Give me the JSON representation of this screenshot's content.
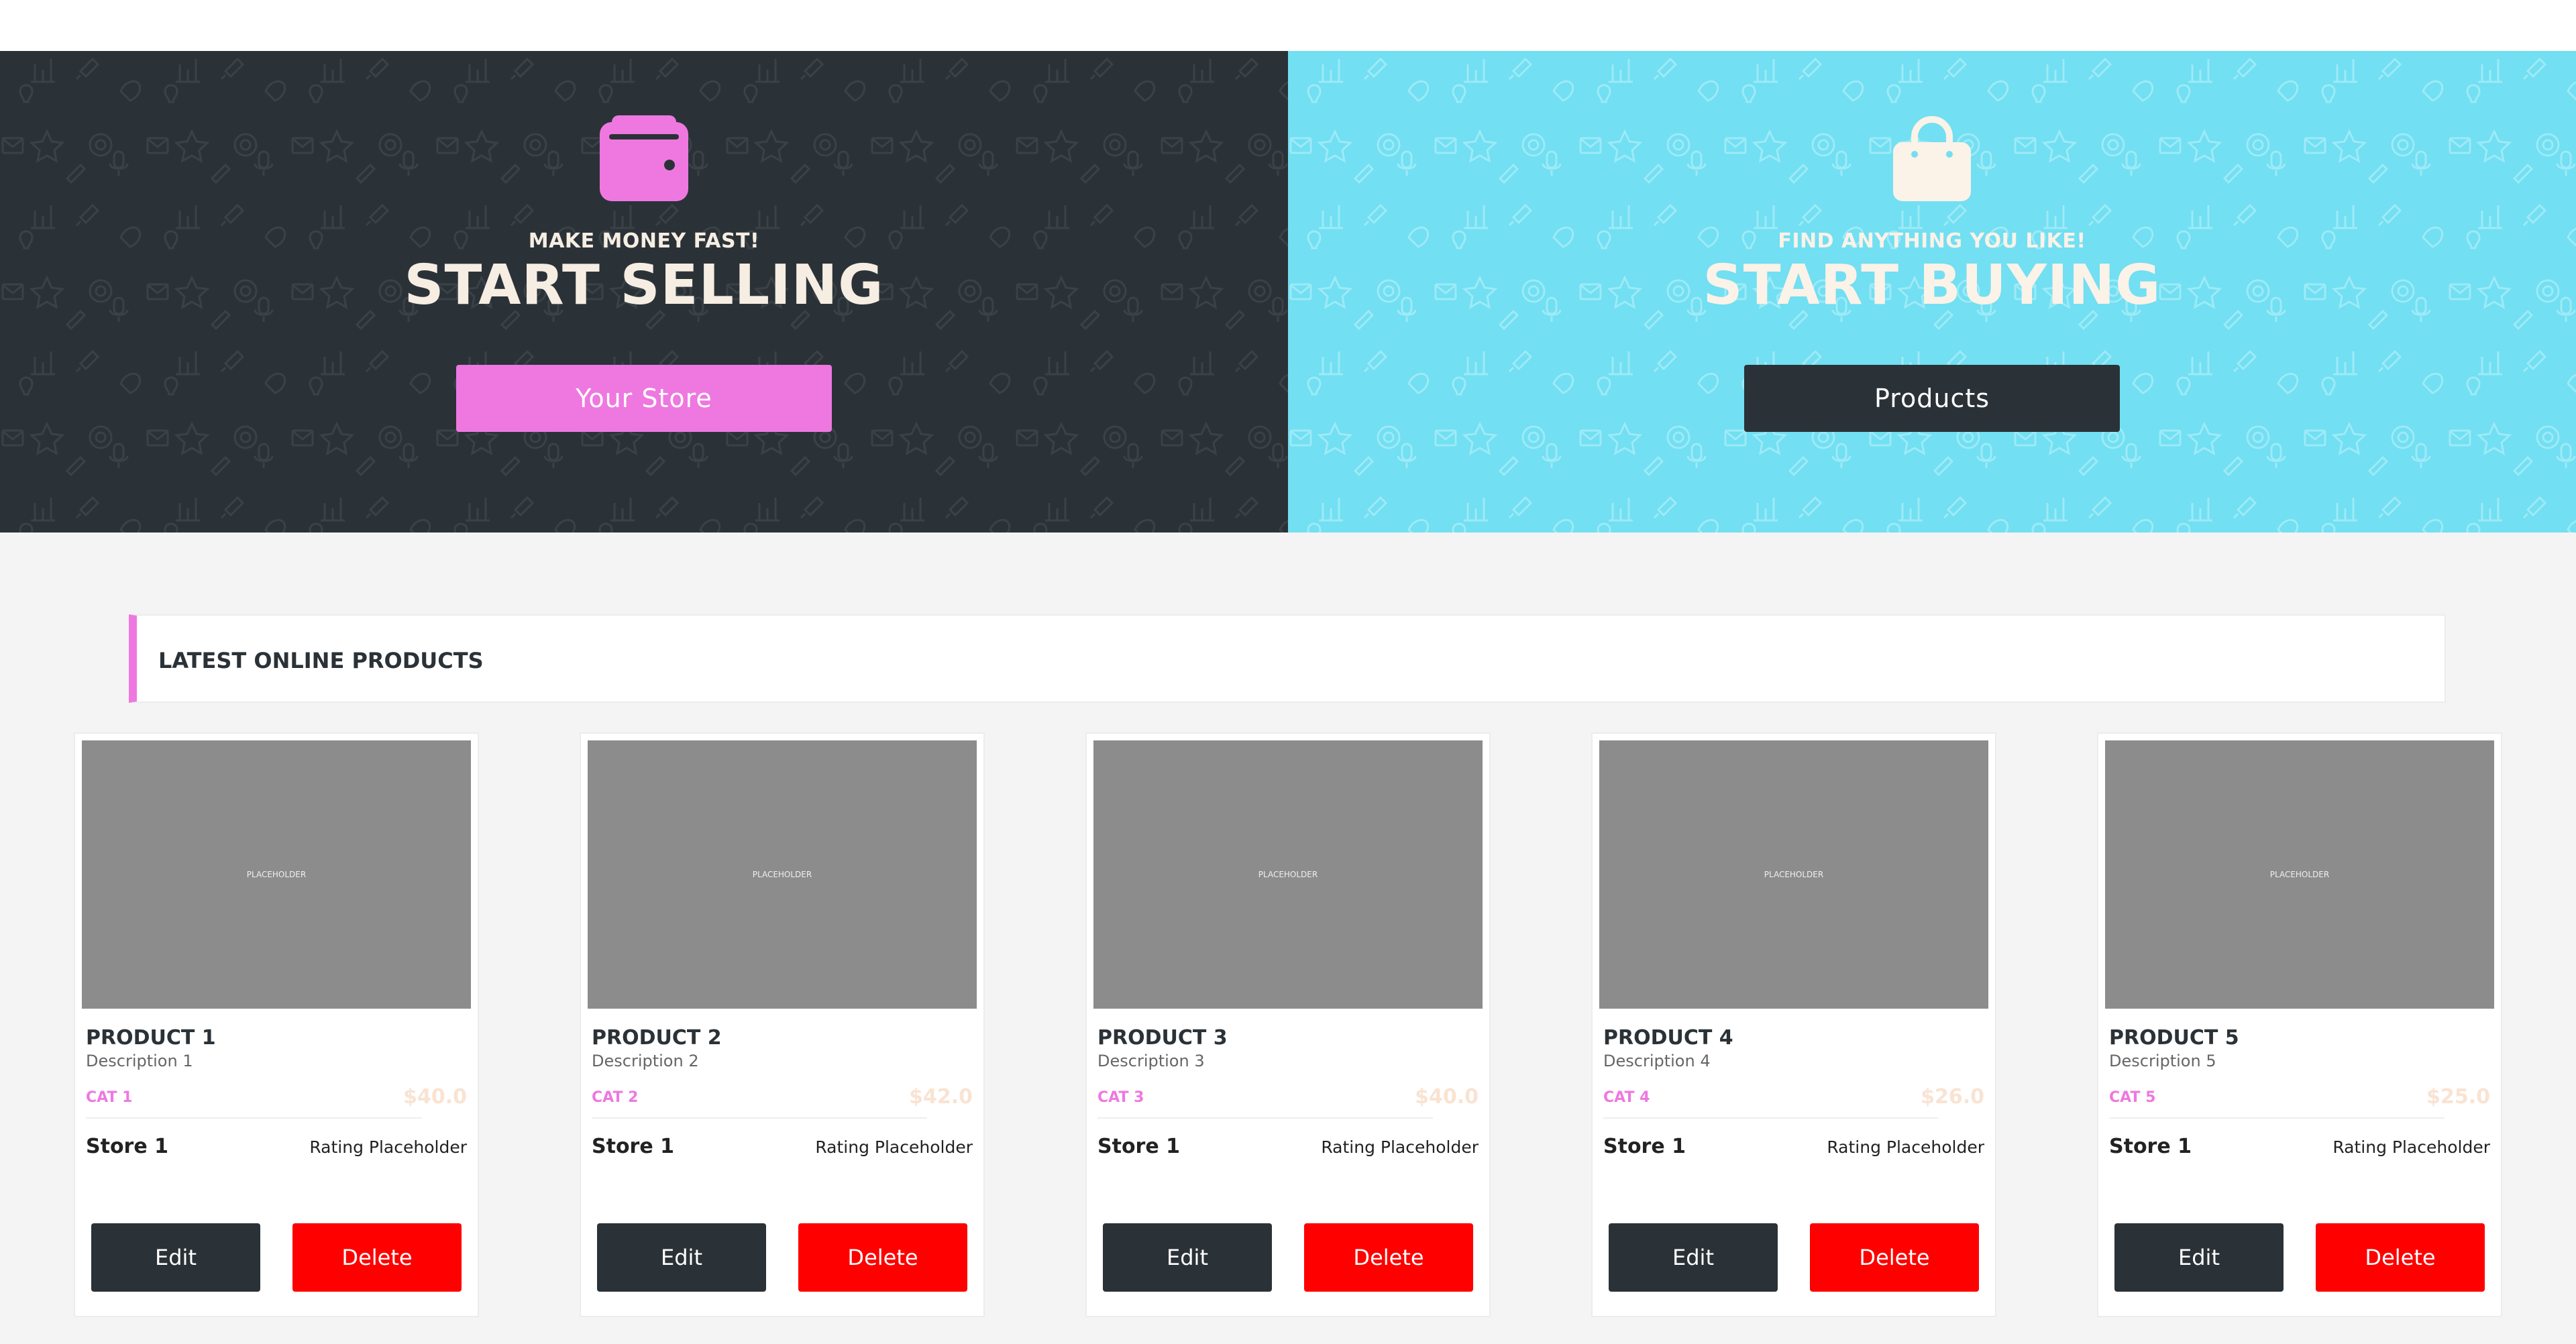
{
  "colors": {
    "dark": "#2b3237",
    "cyan": "#72dff2",
    "pink": "#ee78e0",
    "red": "#ff0000",
    "cream": "#f6ede3",
    "page_bg": "#f4f4f4"
  },
  "hero_sell": {
    "icon": "wallet-icon",
    "kicker": "MAKE MONEY FAST!",
    "title": "START SELLING",
    "button_label": "Your Store"
  },
  "hero_buy": {
    "icon": "shopping-bag-icon",
    "kicker": "FIND ANYTHING YOU LIKE!",
    "title": "START BUYING",
    "button_label": "Products"
  },
  "pattern_icons": [
    "envelope-icon",
    "star-icon",
    "thumbs-down-icon",
    "wrench-icon",
    "lifebuoy-icon",
    "bar-chart-icon",
    "thumbs-up-icon",
    "rocket-icon",
    "microphone-icon",
    "lightbulb-icon",
    "pencil-icon",
    "paper-plane-icon"
  ],
  "section": {
    "title": "LATEST ONLINE PRODUCTS"
  },
  "products": [
    {
      "image_text": "PLACEHOLDER",
      "name": "PRODUCT 1",
      "description": "Description 1",
      "category": "CAT 1",
      "price": "$40.0",
      "store": "Store 1",
      "rating": "Rating Placeholder",
      "edit_label": "Edit",
      "delete_label": "Delete"
    },
    {
      "image_text": "PLACEHOLDER",
      "name": "PRODUCT 2",
      "description": "Description 2",
      "category": "CAT 2",
      "price": "$42.0",
      "store": "Store 1",
      "rating": "Rating Placeholder",
      "edit_label": "Edit",
      "delete_label": "Delete"
    },
    {
      "image_text": "PLACEHOLDER",
      "name": "PRODUCT 3",
      "description": "Description 3",
      "category": "CAT 3",
      "price": "$40.0",
      "store": "Store 1",
      "rating": "Rating Placeholder",
      "edit_label": "Edit",
      "delete_label": "Delete"
    },
    {
      "image_text": "PLACEHOLDER",
      "name": "PRODUCT 4",
      "description": "Description 4",
      "category": "CAT 4",
      "price": "$26.0",
      "store": "Store 1",
      "rating": "Rating Placeholder",
      "edit_label": "Edit",
      "delete_label": "Delete"
    },
    {
      "image_text": "PLACEHOLDER",
      "name": "PRODUCT 5",
      "description": "Description 5",
      "category": "CAT 5",
      "price": "$25.0",
      "store": "Store 1",
      "rating": "Rating Placeholder",
      "edit_label": "Edit",
      "delete_label": "Delete"
    }
  ]
}
